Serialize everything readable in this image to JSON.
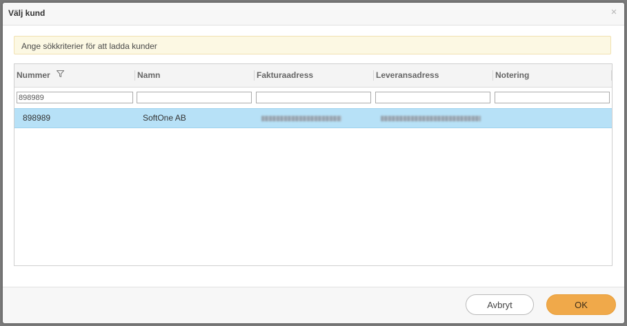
{
  "dialog": {
    "title": "Välj kund",
    "close_glyph": "×"
  },
  "info": {
    "text": "Ange sökkriterier för att ladda kunder"
  },
  "grid": {
    "columns": [
      {
        "label": "Nummer",
        "filter_icon": "filter-icon"
      },
      {
        "label": "Namn"
      },
      {
        "label": "Fakturaadress"
      },
      {
        "label": "Leveransadress"
      },
      {
        "label": "Notering"
      }
    ],
    "filters": [
      "898989",
      "",
      "",
      "",
      ""
    ],
    "rows": [
      {
        "nummer": "898989",
        "namn": "SoftOne AB",
        "fakturaadress": "(blurred)",
        "leveransadress": "(blurred)",
        "notering": ""
      }
    ],
    "selected_row_color": "#b7e1f7"
  },
  "footer": {
    "cancel_label": "Avbryt",
    "ok_label": "OK",
    "ok_color": "#f0a94a"
  }
}
